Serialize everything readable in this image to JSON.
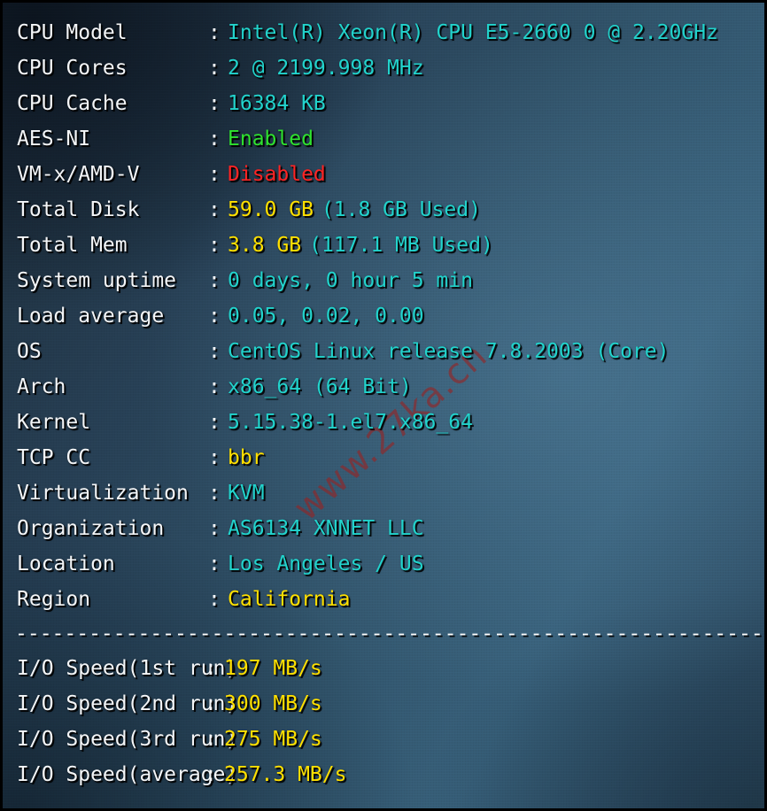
{
  "terminal": {
    "colors": {
      "label": "#f4f6f8",
      "cyan": "#22d3cc",
      "yellow": "#ffe000",
      "green": "#2fe22f",
      "red": "#ff2424",
      "background_dark": "#1d2c3a",
      "background_light": "#375f79"
    },
    "watermark": "www.27ka.cn",
    "divider": "-------------------------------------------------------------------",
    "separator": ":"
  },
  "system_info": {
    "rows": [
      {
        "label": "CPU Model",
        "value": "Intel(R) Xeon(R) CPU E5-2660 0 @ 2.20GHz",
        "color": "cyan",
        "extra": "",
        "extra_color": "cyan"
      },
      {
        "label": "CPU Cores",
        "value": "2 @ 2199.998 MHz",
        "color": "cyan",
        "extra": "",
        "extra_color": "cyan"
      },
      {
        "label": "CPU Cache",
        "value": "16384 KB",
        "color": "cyan",
        "extra": "",
        "extra_color": "cyan"
      },
      {
        "label": "AES-NI",
        "value": "Enabled",
        "color": "green",
        "extra": "",
        "extra_color": "cyan"
      },
      {
        "label": "VM-x/AMD-V",
        "value": "Disabled",
        "color": "red",
        "extra": "",
        "extra_color": "cyan"
      },
      {
        "label": "Total Disk",
        "value": "59.0 GB",
        "color": "yellow",
        "extra": "(1.8 GB Used)",
        "extra_color": "cyan"
      },
      {
        "label": "Total Mem",
        "value": "3.8 GB",
        "color": "yellow",
        "extra": "(117.1 MB Used)",
        "extra_color": "cyan"
      },
      {
        "label": "System uptime",
        "value": "0 days, 0 hour 5 min",
        "color": "cyan",
        "extra": "",
        "extra_color": "cyan"
      },
      {
        "label": "Load average",
        "value": "0.05, 0.02, 0.00",
        "color": "cyan",
        "extra": "",
        "extra_color": "cyan"
      },
      {
        "label": "OS",
        "value": "CentOS Linux release 7.8.2003 (Core)",
        "color": "cyan",
        "extra": "",
        "extra_color": "cyan"
      },
      {
        "label": "Arch",
        "value": "x86_64 (64 Bit)",
        "color": "cyan",
        "extra": "",
        "extra_color": "cyan"
      },
      {
        "label": "Kernel",
        "value": "5.15.38-1.el7.x86_64",
        "color": "cyan",
        "extra": "",
        "extra_color": "cyan"
      },
      {
        "label": "TCP CC",
        "value": "bbr",
        "color": "yellow",
        "extra": "",
        "extra_color": "cyan"
      },
      {
        "label": "Virtualization",
        "value": "KVM",
        "color": "cyan",
        "extra": "",
        "extra_color": "cyan"
      },
      {
        "label": "Organization",
        "value": "AS6134 XNNET LLC",
        "color": "cyan",
        "extra": "",
        "extra_color": "cyan"
      },
      {
        "label": "Location",
        "value": "Los Angeles / US",
        "color": "cyan",
        "extra": "",
        "extra_color": "cyan"
      },
      {
        "label": "Region",
        "value": "California",
        "color": "yellow",
        "extra": "",
        "extra_color": "cyan"
      }
    ]
  },
  "io_speed": {
    "rows": [
      {
        "label": "I/O Speed(1st run)",
        "value": "197 MB/s",
        "color": "yellow"
      },
      {
        "label": "I/O Speed(2nd run)",
        "value": "300 MB/s",
        "color": "yellow"
      },
      {
        "label": "I/O Speed(3rd run)",
        "value": "275 MB/s",
        "color": "yellow"
      },
      {
        "label": "I/O Speed(average)",
        "value": "257.3 MB/s",
        "color": "yellow"
      }
    ]
  }
}
